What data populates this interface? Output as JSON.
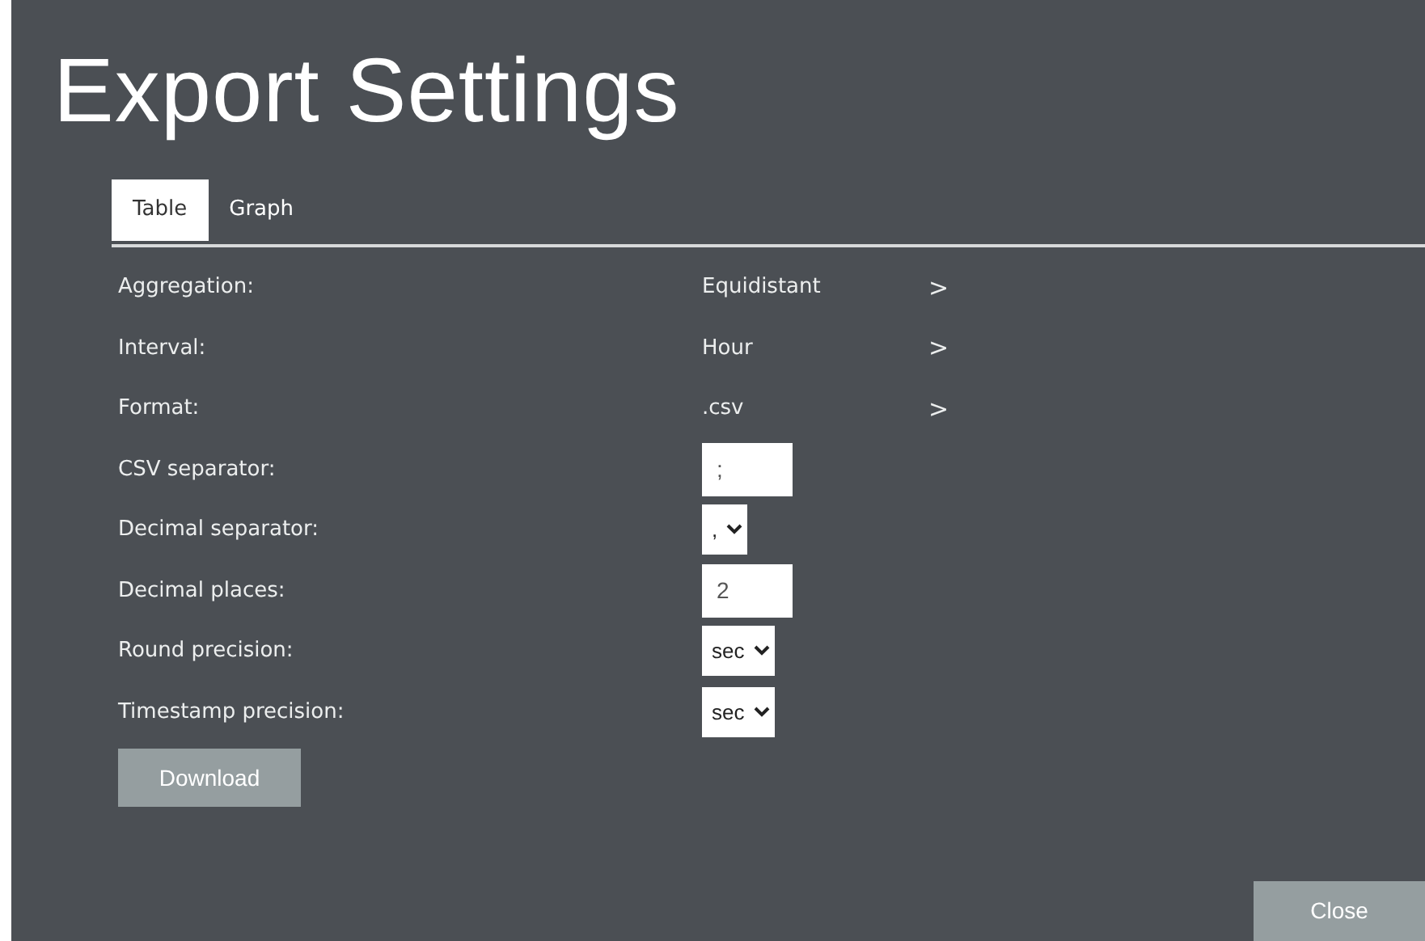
{
  "title": "Export Settings",
  "tabs": [
    {
      "label": "Table",
      "selected": true
    },
    {
      "label": "Graph",
      "selected": false
    }
  ],
  "settings": [
    {
      "kind": "nav",
      "label": "Aggregation:",
      "value": "Equidistant",
      "chevron": ">"
    },
    {
      "kind": "nav",
      "label": "Interval:",
      "value": "Hour",
      "chevron": ">"
    },
    {
      "kind": "nav",
      "label": "Format:",
      "value": ".csv",
      "chevron": ">"
    },
    {
      "kind": "input",
      "label": "CSV separator:",
      "value": ";"
    },
    {
      "kind": "select",
      "label": "Decimal separator:",
      "value": ","
    },
    {
      "kind": "input",
      "label": "Decimal places:",
      "value": "2"
    },
    {
      "kind": "select",
      "label": "Round precision:",
      "value": "sec"
    },
    {
      "kind": "select",
      "label": "Timestamp precision:",
      "value": "sec"
    }
  ],
  "download_button": "Download",
  "close_button": "Close"
}
